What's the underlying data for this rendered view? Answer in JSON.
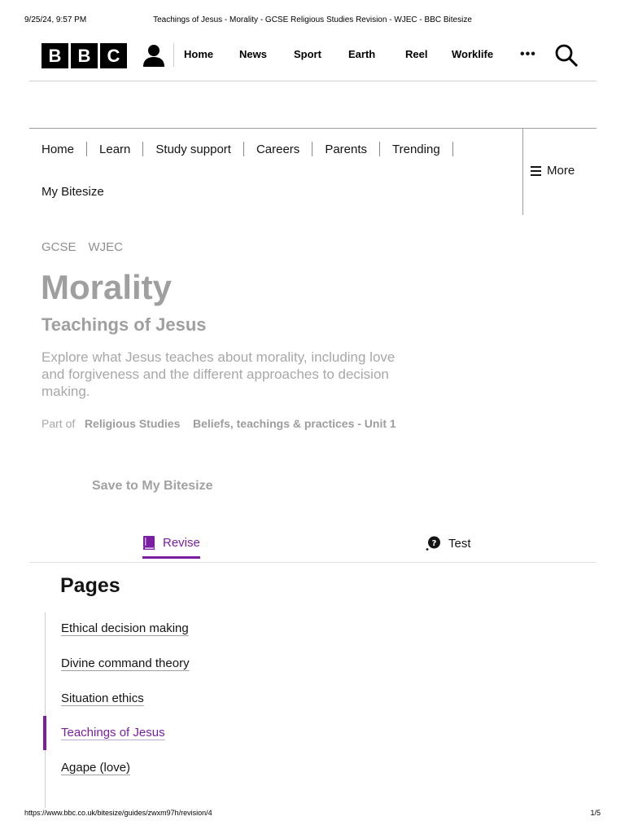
{
  "print": {
    "date": "9/25/24, 9:57 PM",
    "title": "Teachings of Jesus - Morality - GCSE Religious Studies Revision - WJEC - BBC Bitesize",
    "url": "https://www.bbc.co.uk/bitesize/guides/zwxm97h/revision/4",
    "page": "1/5"
  },
  "bbc_nav": {
    "logo_letters": [
      "B",
      "B",
      "C"
    ],
    "links": [
      "Home",
      "News",
      "Sport",
      "Earth",
      "Reel",
      "Worklife"
    ],
    "more": "•••"
  },
  "bitesize_nav": {
    "items": [
      "Home",
      "Learn",
      "Study support",
      "Careers",
      "Parents",
      "Trending"
    ],
    "second_row": "My Bitesize",
    "more_label": "More"
  },
  "guide": {
    "crumbs": [
      "GCSE",
      "WJEC"
    ],
    "topic": "Morality",
    "subtitle": "Teachings of Jesus",
    "description": "Explore what Jesus teaches about morality, including love and forgiveness and the different approaches to decision making.",
    "part_of_label": "Part of",
    "part_of_subject": "Religious Studies",
    "part_of_unit": "Beliefs, teachings & practices - Unit 1",
    "save_label": "Save to My Bitesize"
  },
  "tabs": {
    "revise": "Revise",
    "test": "Test",
    "active": "Revise",
    "accent_color": "#7b1fa2"
  },
  "pages": {
    "heading": "Pages",
    "items": [
      "Ethical decision making",
      "Divine command theory",
      "Situation ethics",
      "Teachings of Jesus",
      "Agape (love)"
    ],
    "active_index": 3
  }
}
